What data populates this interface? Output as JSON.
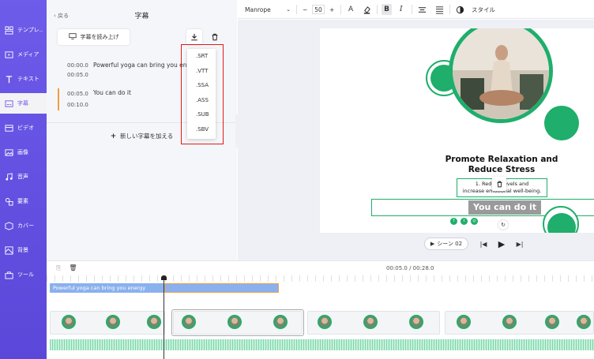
{
  "nav": {
    "items": [
      {
        "label": "テンプレ..",
        "icon": "template-icon"
      },
      {
        "label": "メディア",
        "icon": "media-icon"
      },
      {
        "label": "テキスト",
        "icon": "text-icon"
      },
      {
        "label": "字幕",
        "icon": "subtitle-icon",
        "active": true
      },
      {
        "label": "ビデオ",
        "icon": "video-icon"
      },
      {
        "label": "画像",
        "icon": "image-icon"
      },
      {
        "label": "音声",
        "icon": "audio-icon"
      },
      {
        "label": "要素",
        "icon": "elements-icon"
      },
      {
        "label": "カバー",
        "icon": "cover-icon"
      },
      {
        "label": "背景",
        "icon": "background-icon"
      },
      {
        "label": "ツール",
        "icon": "tools-icon"
      }
    ]
  },
  "panel": {
    "back_label": "戻る",
    "title": "字幕",
    "read_button": "字幕を読み上げ",
    "subtitles": [
      {
        "start": "00:00.0",
        "end": "00:05.0",
        "text": "Powerful yoga can bring you energy"
      },
      {
        "start": "00:05.0",
        "end": "00:10.0",
        "text": "You can do it"
      }
    ],
    "add_label": "新しい字幕を加える"
  },
  "dropdown": {
    "options": [
      ".SRT",
      ".VTT",
      ".SSA",
      ".ASS",
      ".SUB",
      ".SBV"
    ]
  },
  "toolbar": {
    "font": "Manrope",
    "size": "50",
    "minus": "−",
    "plus": "+",
    "style_label": "スタイル"
  },
  "canvas": {
    "headline": "Promote Relaxation and Reduce Stress",
    "body_line1": "1. Reduce       levels and",
    "body_line2": "increase emotional well-being.",
    "subtitle_text": "You can do it",
    "accent_color": "#1fae6b"
  },
  "playback": {
    "scene_label": "シーン 02"
  },
  "timeline": {
    "time": "00:05.0 / 00:28.0",
    "track1_text": "Powerful yoga can bring you energy"
  }
}
